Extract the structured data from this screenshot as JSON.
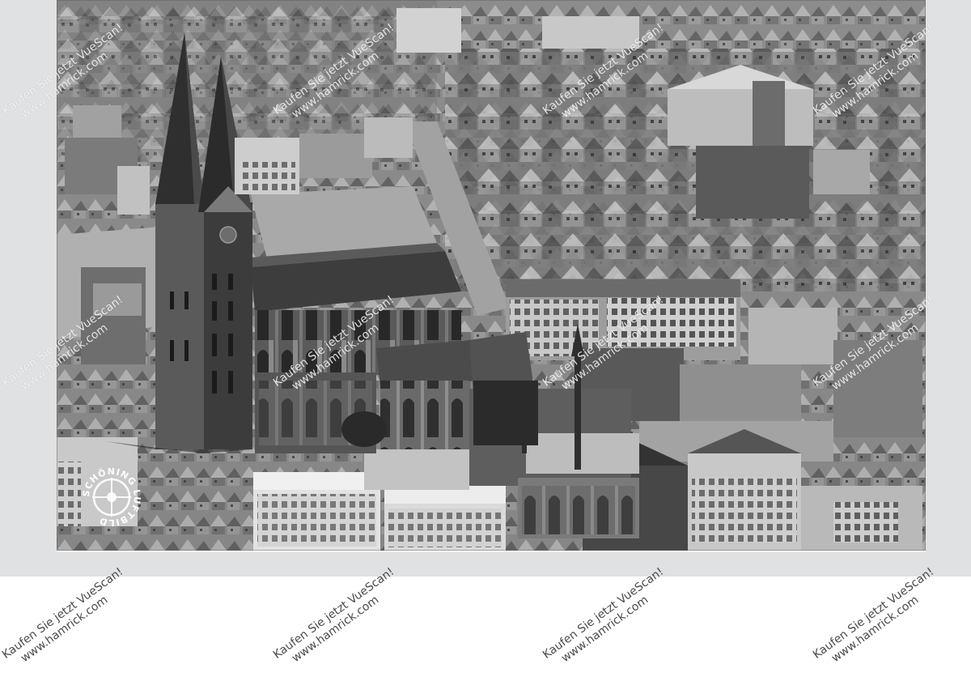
{
  "watermark": {
    "line1": "Kaufen Sie jetzt VueScan!",
    "line2": "www.hamrick.com"
  },
  "stamp": {
    "logo_text": "SCHÖNING LUFTBILD"
  },
  "colors": {
    "mat": "#dfe1e2",
    "photo_base": "#8c8c8c",
    "watermark_light": "#ffffff",
    "watermark_dark": "#4a4a4a"
  }
}
